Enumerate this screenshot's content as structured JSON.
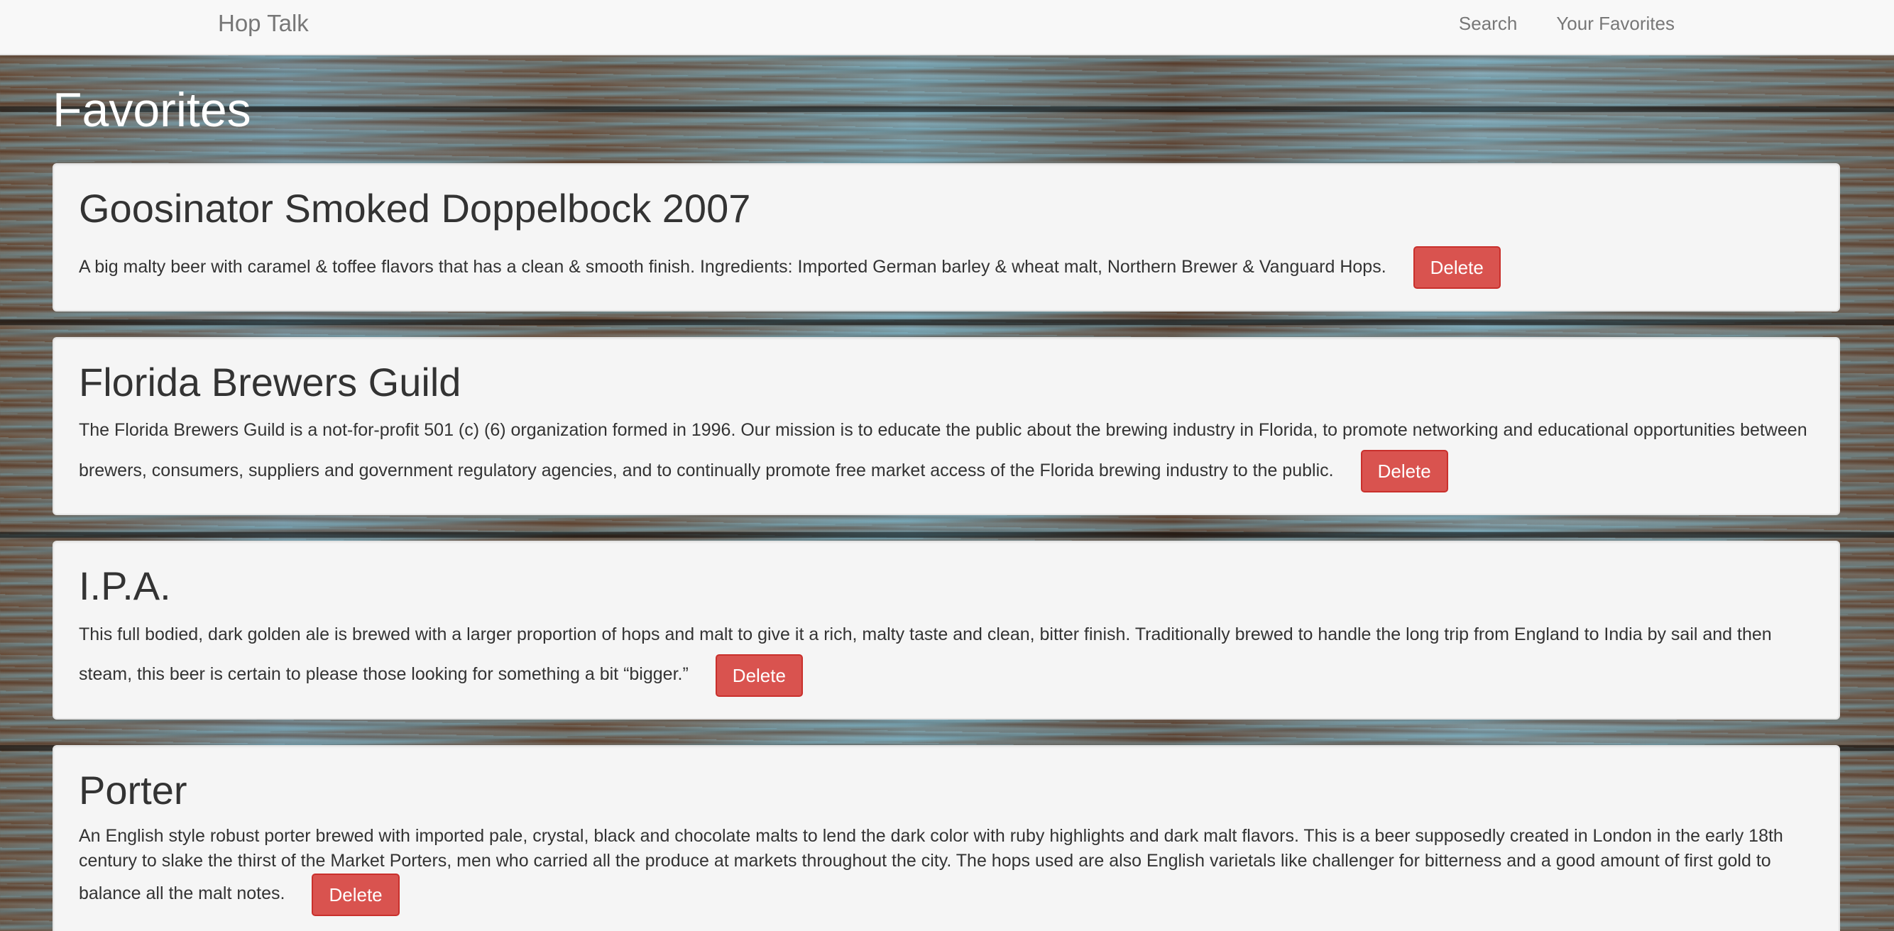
{
  "navbar": {
    "brand": "Hop Talk",
    "links": [
      "Search",
      "Your Favorites"
    ]
  },
  "page": {
    "title": "Favorites"
  },
  "favorites": [
    {
      "name": "Goosinator Smoked Doppelbock 2007",
      "description": "A big malty beer with caramel & toffee flavors that has a clean & smooth finish. Ingredients: Imported German barley & wheat malt, Northern Brewer & Vanguard Hops.",
      "delete_label": "Delete"
    },
    {
      "name": "Florida Brewers Guild",
      "description": "The Florida Brewers Guild is a not-for-profit 501 (c) (6) organization formed in 1996. Our mission is to educate the public about the brewing industry in Florida, to promote networking and educational opportunities between brewers, consumers, suppliers and government regulatory agencies, and to continually promote free market access of the Florida brewing industry to the public.",
      "delete_label": "Delete"
    },
    {
      "name": "I.P.A.",
      "description": "This full bodied, dark golden ale is brewed with a larger proportion of hops and malt to give it a rich, malty taste and clean, bitter finish. Traditionally brewed to handle the long trip from England to India by sail and then steam, this beer is certain to please those looking for something a bit “bigger.”",
      "delete_label": "Delete"
    },
    {
      "name": "Porter",
      "description": "An English style robust porter brewed with imported pale, crystal, black and chocolate malts to lend the dark color with ruby highlights and dark malt flavors. This is a beer supposedly created in London in the early 18th century to slake the thirst of the Market Porters, men who carried all the produce at markets throughout the city. The hops used are also English varietals like challenger for bitterness and a good amount of first gold to balance all the malt notes.",
      "delete_label": "Delete"
    }
  ]
}
